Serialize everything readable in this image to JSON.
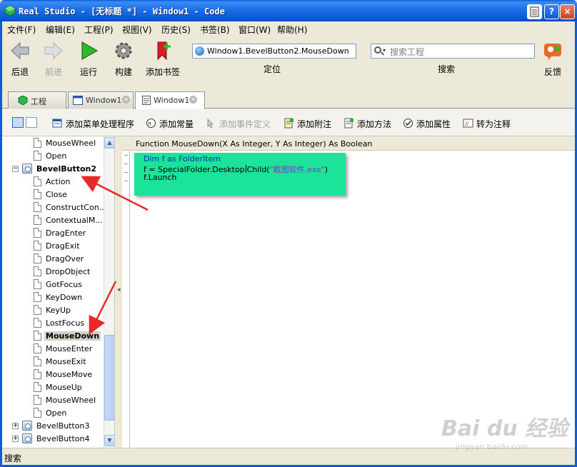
{
  "window": {
    "title": "Real Studio - [无标题 *] - Window1 - Code",
    "titlebar_buttons": [
      "?",
      "×"
    ]
  },
  "menu": [
    "文件(F)",
    "编辑(E)",
    "工程(P)",
    "视图(V)",
    "历史(S)",
    "书签(B)",
    "窗口(W)",
    "帮助(H)"
  ],
  "toolbar": {
    "back": "后退",
    "forward": "前进",
    "run": "运行",
    "build": "构建",
    "add_bookmark": "添加书签",
    "location_value": "Window1.BevelButton2.MouseDown",
    "location_label": "定位",
    "search_placeholder": "搜索工程",
    "search_label": "搜索",
    "feedback": "反馈"
  },
  "tabs": [
    {
      "label": "工程",
      "active": false
    },
    {
      "label": "Window1",
      "active": false
    },
    {
      "label": "Window1",
      "active": true
    }
  ],
  "commands": {
    "add_menu_handler": "添加菜单处理程序",
    "add_constant": "添加常量",
    "add_event_definition": "添加事件定义",
    "add_note": "添加附注",
    "add_method": "添加方法",
    "add_property": "添加属性",
    "convert_to_comment": "转为注释"
  },
  "tree": {
    "top_items": [
      "MouseWheel",
      "Open"
    ],
    "group_bevelbutton2": "BevelButton2",
    "events": [
      "Action",
      "Close",
      "ConstructCon...",
      "ContextualM...",
      "DragEnter",
      "DragExit",
      "DragOver",
      "DropObject",
      "GotFocus",
      "KeyDown",
      "KeyUp",
      "LostFocus",
      "MouseDown",
      "MouseEnter",
      "MouseExit",
      "MouseMove",
      "MouseUp",
      "MouseWheel",
      "Open"
    ],
    "selected_event": "MouseDown",
    "group_bevelbutton3": "BevelButton3",
    "group_bevelbutton4": "BevelButton4"
  },
  "editor": {
    "signature": "Function MouseDown(X As Integer, Y As Integer) As Boolean",
    "line1_kw1": "Dim",
    "line1_rest": " f as FolderItem",
    "line2_a": "f = SpecialFolder.Desktop",
    "line2_b": "Child(",
    "line2_str": "\"截图软件.exe\"",
    "line2_c": ")",
    "line3": "f.Launch"
  },
  "status": {
    "text": "搜索"
  },
  "watermark": {
    "brand": "Bai du 经验",
    "url": "jingyan.baidu.com"
  },
  "colors": {
    "titlebar": "#0A5FD8",
    "code_highlight": "#1BE49A",
    "annotation_arrow": "#E52A2A"
  }
}
